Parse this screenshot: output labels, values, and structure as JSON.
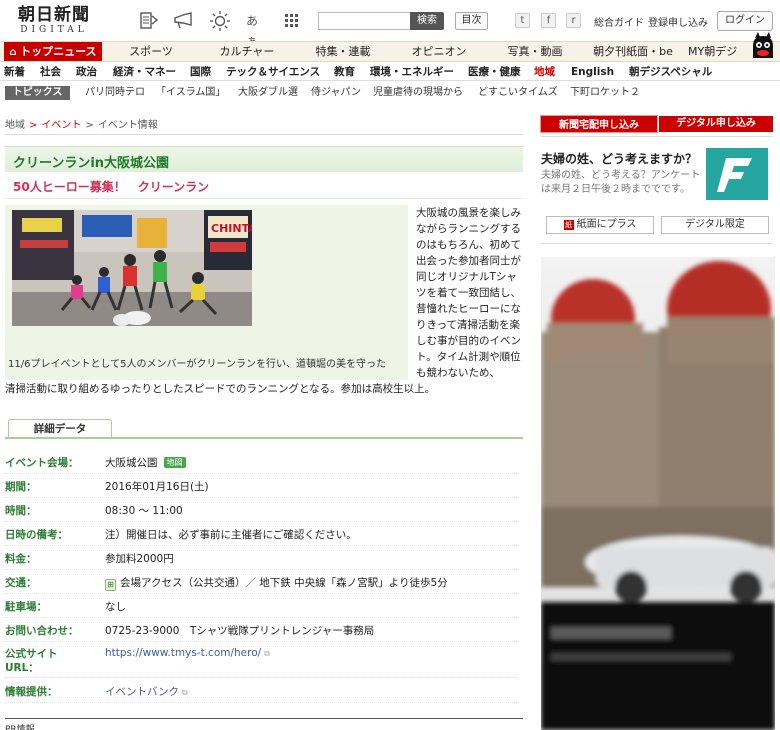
{
  "header": {
    "logo_main": "朝日新聞",
    "logo_sub": "DIGITAL",
    "search_placeholder": "",
    "search_button": "検索",
    "mokuji_button": "目次",
    "social": [
      "twitter",
      "facebook",
      "rss"
    ],
    "social_glyphs": [
      "t",
      "f",
      "r"
    ],
    "guide_link": "総合ガイド",
    "signup_link": "登録申し込み",
    "login_button": "ログイン",
    "icons": [
      "text-size-icon",
      "megaphone-icon",
      "weather-icon",
      "hiragana-icon",
      "grid-menu-icon"
    ],
    "hiragana_text": "あぁ"
  },
  "nav_main": {
    "top_label": "トップニュース",
    "items": [
      "スポーツ",
      "カルチャー",
      "特集・連載",
      "オピニオン",
      "写真・動画",
      "朝夕刊紙面・be",
      "MY朝デジ"
    ]
  },
  "nav_sub": {
    "items": [
      "新着",
      "社会",
      "政治",
      "経済・マネー",
      "国際",
      "テック＆サイエンス",
      "教育",
      "環境・エネルギー",
      "医療・健康",
      "地域",
      "English",
      "朝デジスペシャル"
    ],
    "active": "地域"
  },
  "topics": {
    "label": "トピックス",
    "items": [
      "パリ同時テロ",
      "「イスラム国」",
      "大阪ダブル選",
      "侍ジャパン",
      "児童虐待の現場から",
      "どすこいタイムズ",
      "下町ロケット２"
    ]
  },
  "breadcrumb": [
    "地域",
    "イベント",
    "イベント情報"
  ],
  "article": {
    "title": "クリーンランin大阪城公園",
    "subtitle": "50人ヒーロー募集！　クリーンラン",
    "photo_sign": "CHINTAI",
    "caption": "11/6プレイベントとして5人のメンバーがクリーンランを行い、道頓堀の美を守った",
    "body_side": "大阪城の風景を楽しみながらランニングするのはもちろん、初めて出会った参加者同士が同じオリジナルTシャツを着て一致団結し、昔憧れたヒーローになりきって清掃活動を楽しむ事が目的のイベント。タイム計測や順位も競わないため、",
    "body_full": "清掃活動に取り組めるゆったりとしたスピードでのランニングとなる。参加は高校生以上。"
  },
  "details": {
    "tab_label": "詳細データ",
    "rows": [
      {
        "label": "イベント会場：",
        "value": "大阪城公園",
        "badge": "地図"
      },
      {
        "label": "期間：",
        "value": "2016年01月16日(土)"
      },
      {
        "label": "時間：",
        "value": "08:30 ～ 11:00"
      },
      {
        "label": "日時の備考：",
        "value": "注）開催日は、必ず事前に主催者にご確認ください。"
      },
      {
        "label": "料金：",
        "value": "参加料2000円"
      },
      {
        "label": "交通：",
        "value": "会場アクセス（公共交通）／ 地下鉄 中央線「森ノ宮駅」より徒歩5分",
        "icon": "train-icon",
        "icon_glyph": "⊞"
      },
      {
        "label": "駐車場：",
        "value": "なし"
      },
      {
        "label": "お問い合わせ：",
        "value": "0725-23-9000　Tシャツ戦隊プリントレンジャー事務局"
      },
      {
        "label": "公式サイト URL：",
        "value": "https://www.tmys-t.com/hero/"
      },
      {
        "label": "情報提供：",
        "value": "イベントバンク"
      }
    ]
  },
  "footer": {
    "pr_label": "PR情報"
  },
  "sidebar": {
    "btn_shinbun": "新聞宅配申し込み",
    "btn_digital": "デジタル申し込み",
    "question_title": "夫婦の姓、どう考えますか？",
    "question_text": "夫婦の姓、どう考える？アンケートは来月２日午後２時まででです。",
    "btn_plus": "紙面にプラス",
    "btn_plus_icon": "紙",
    "btn_gentei": "デジタル限定"
  },
  "colors": {
    "brand_red": "#c60000",
    "accent_green": "#2b7d33",
    "title_green": "#1d7a2a",
    "subtitle_pink": "#d0305a",
    "teal_logo": "#25a6a0"
  }
}
